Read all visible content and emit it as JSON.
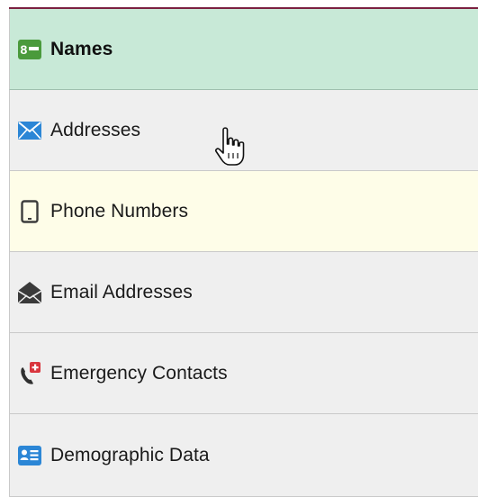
{
  "nav": {
    "items": [
      {
        "label": "Names",
        "icon": "name-card-icon",
        "state": "selected"
      },
      {
        "label": "Addresses",
        "icon": "envelope-icon",
        "state": "normal"
      },
      {
        "label": "Phone Numbers",
        "icon": "mobile-phone-icon",
        "state": "hover"
      },
      {
        "label": "Email Addresses",
        "icon": "open-envelope-icon",
        "state": "normal"
      },
      {
        "label": "Emergency Contacts",
        "icon": "emergency-phone-icon",
        "state": "normal"
      },
      {
        "label": "Demographic Data",
        "icon": "id-card-icon",
        "state": "normal"
      }
    ]
  },
  "colors": {
    "selected_background": "#c8e9d7",
    "hover_background": "#fefde8",
    "default_background": "#efefef",
    "top_rule": "#7b2140",
    "names_icon": "#4a9a3c",
    "addresses_icon": "#2b86d6",
    "emergency_badge": "#d9363e",
    "demographic_icon": "#2b86d6"
  },
  "cursor": {
    "icon": "hand-pointer-icon"
  }
}
